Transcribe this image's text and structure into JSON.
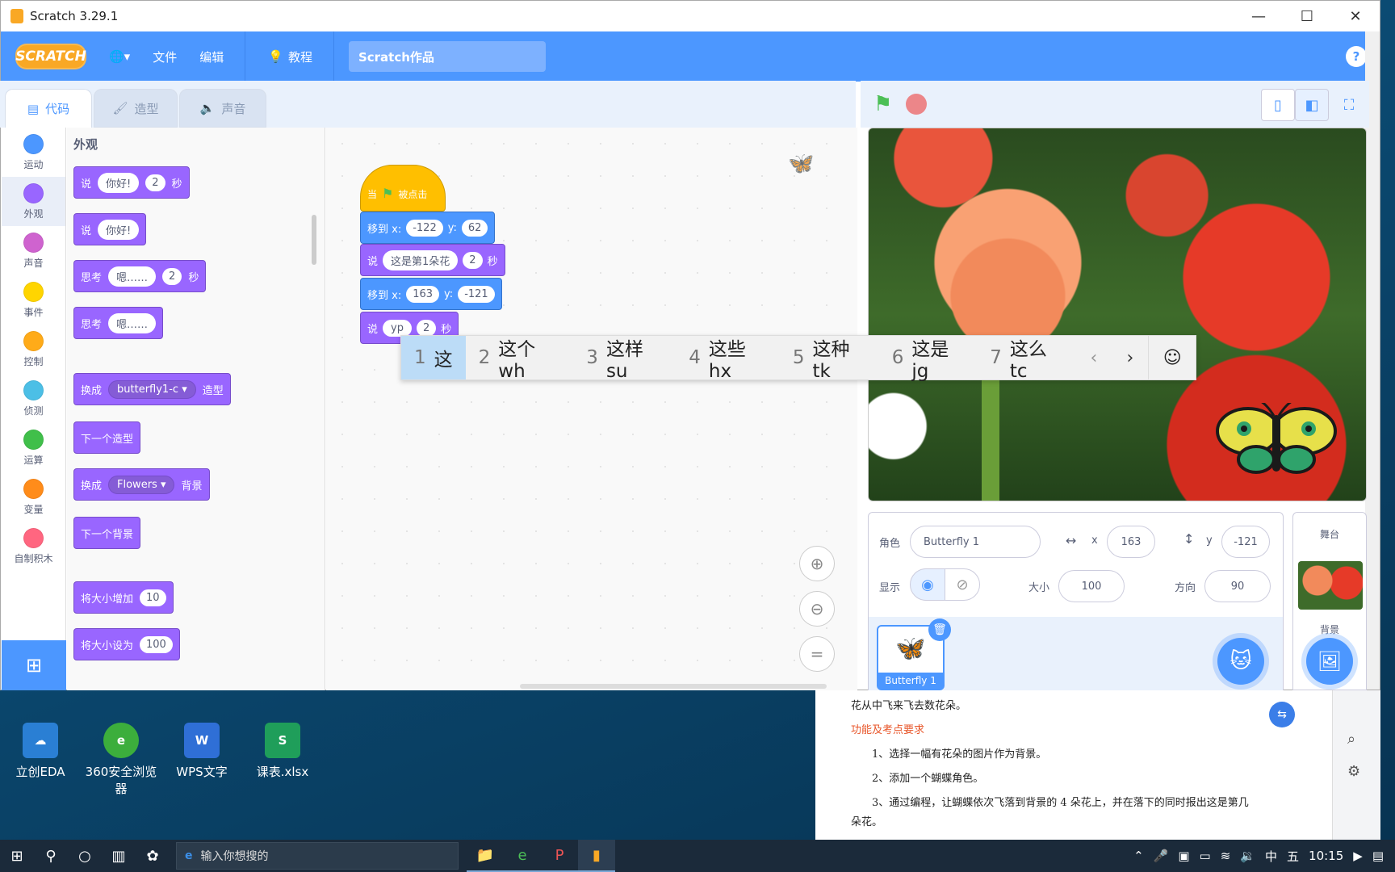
{
  "window": {
    "title": "Scratch 3.29.1",
    "controls": [
      "—",
      "☐",
      "✕"
    ]
  },
  "menubar": {
    "logo": "SCRATCH",
    "globe": "🌐▾",
    "file": "文件",
    "edit": "编辑",
    "tutorials": "教程",
    "project_title": "Scratch作品",
    "help": "?"
  },
  "tabs": {
    "code": "代码",
    "costumes": "造型",
    "sounds": "声音"
  },
  "categories": [
    {
      "label": "运动",
      "color": "#4c97ff"
    },
    {
      "label": "外观",
      "color": "#9966ff"
    },
    {
      "label": "声音",
      "color": "#cf63cf"
    },
    {
      "label": "事件",
      "color": "#ffd500"
    },
    {
      "label": "控制",
      "color": "#ffab19"
    },
    {
      "label": "侦测",
      "color": "#4cbfe6"
    },
    {
      "label": "运算",
      "color": "#40bf4a"
    },
    {
      "label": "变量",
      "color": "#ff8c1a"
    },
    {
      "label": "自制积木",
      "color": "#ff6680"
    }
  ],
  "palette": {
    "title": "外观",
    "say_secs": {
      "say": "说",
      "msg": "你好!",
      "secs": "2",
      "unit": "秒"
    },
    "say": {
      "say": "说",
      "msg": "你好!"
    },
    "think_secs": {
      "think": "思考",
      "msg": "嗯……",
      "secs": "2",
      "unit": "秒"
    },
    "think": {
      "think": "思考",
      "msg": "嗯……"
    },
    "switch_costume": {
      "label": "换成",
      "value": "butterfly1-c",
      "suffix": "造型"
    },
    "next_costume": "下一个造型",
    "switch_backdrop": {
      "label": "换成",
      "value": "Flowers",
      "suffix": "背景"
    },
    "next_backdrop": "下一个背景",
    "change_size": {
      "label": "将大小增加",
      "value": "10"
    },
    "set_size": {
      "label": "将大小设为",
      "value": "100"
    }
  },
  "script": {
    "hat": {
      "when": "当",
      "clicked": "被点击"
    },
    "goto1": {
      "label": "移到 x:",
      "x": "-122",
      "ylabel": "y:",
      "y": "62"
    },
    "say1": {
      "say": "说",
      "msg": "这是第1朵花",
      "secs": "2",
      "unit": "秒"
    },
    "goto2": {
      "label": "移到 x:",
      "x": "163",
      "ylabel": "y:",
      "y": "-121"
    },
    "say2": {
      "say": "说",
      "msg": "yp",
      "secs": "2",
      "unit": "秒"
    }
  },
  "ime": {
    "candidates": [
      {
        "n": "1",
        "text": "这"
      },
      {
        "n": "2",
        "text": "这个wh"
      },
      {
        "n": "3",
        "text": "这样su"
      },
      {
        "n": "4",
        "text": "这些hx"
      },
      {
        "n": "5",
        "text": "这种tk"
      },
      {
        "n": "6",
        "text": "这是jg"
      },
      {
        "n": "7",
        "text": "这么tc"
      }
    ],
    "prev": "‹",
    "next": "›",
    "emoji": "☺"
  },
  "sprite_info": {
    "sprite_label": "角色",
    "sprite_name": "Butterfly 1",
    "x_label": "x",
    "x": "163",
    "y_label": "y",
    "y": "-121",
    "show_label": "显示",
    "size_label": "大小",
    "size": "100",
    "direction_label": "方向",
    "direction": "90"
  },
  "sprite_list": [
    {
      "name": "Butterfly 1"
    }
  ],
  "stage_pane": {
    "title": "舞台",
    "backdrop_label": "背景"
  },
  "desktop_icons": [
    {
      "label": "立创EDA",
      "color": "#2a7fd4"
    },
    {
      "label": "360安全浏览器",
      "color": "#3cae3c"
    },
    {
      "label": "WPS文字",
      "color": "#2f6fd6"
    },
    {
      "label": "课表.xlsx",
      "color": "#1f9e5a"
    }
  ],
  "document": {
    "line1": "花从中飞来飞去数花朵。",
    "heading": "功能及考点要求",
    "item1": "1、选择一幅有花朵的图片作为背景。",
    "item2": "2、添加一个蝴蝶角色。",
    "item3": "3、通过编程，让蝴蝶依次飞落到背景的 4 朵花上，并在落下的同时报出这是第几",
    "item3b": "朵花。"
  },
  "taskbar": {
    "search_placeholder": "输入你想搜的",
    "ime_mode": "中",
    "ime_name": "五",
    "time": "10:15"
  }
}
